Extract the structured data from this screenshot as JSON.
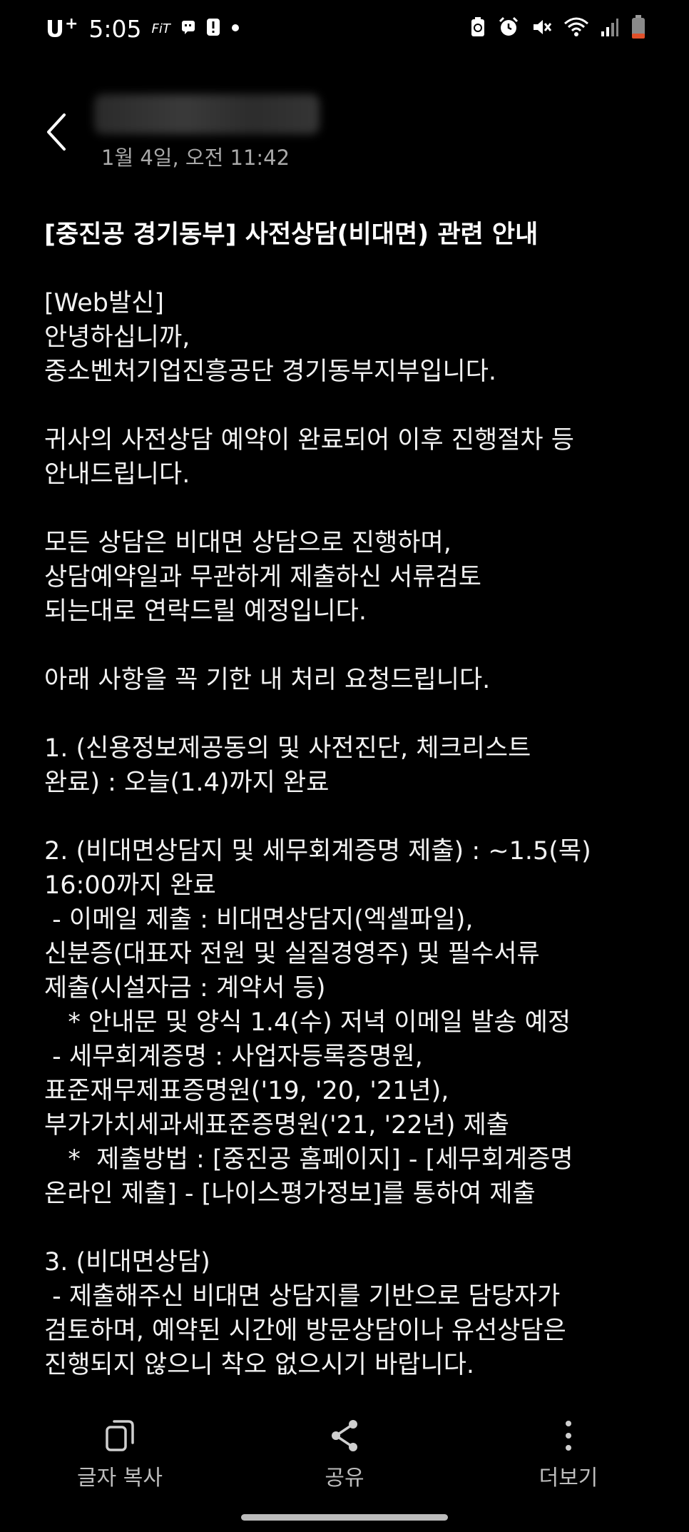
{
  "status_bar": {
    "carrier": "U",
    "carrier_plus": "+",
    "time": "5:05",
    "small_label": "FiT",
    "icons": [
      "message-icon",
      "alert-icon",
      "dot-icon",
      "battery-saver-icon",
      "alarm-icon",
      "mute-icon",
      "wifi-icon",
      "signal-icon",
      "battery-icon"
    ]
  },
  "header": {
    "date": "1월 4일, 오전 11:42"
  },
  "message": {
    "lines": [
      "[중진공 경기동부] 사전상담(비대면) 관련 안내",
      "",
      "[Web발신]",
      "안녕하십니까,",
      "중소벤처기업진흥공단 경기동부지부입니다.",
      "",
      "귀사의 사전상담 예약이 완료되어 이후 진행절차 등",
      "안내드립니다.",
      "",
      "모든 상담은 비대면 상담으로 진행하며,",
      "상담예약일과 무관하게 제출하신 서류검토",
      "되는대로 연락드릴 예정입니다.",
      "",
      "아래 사항을 꼭 기한 내 처리 요청드립니다.",
      "",
      "1. (신용정보제공동의 및 사전진단, 체크리스트",
      "완료) : 오늘(1.4)까지 완료",
      "",
      "2. (비대면상담지 및 세무회계증명 제출) : ~1.5(목)",
      "16:00까지 완료",
      " - 이메일 제출 : 비대면상담지(엑셀파일),",
      "신분증(대표자 전원 및 실질경영주) 및 필수서류",
      "제출(시설자금 : 계약서 등)",
      "   * 안내문 및 양식 1.4(수) 저녁 이메일 발송 예정",
      " - 세무회계증명 : 사업자등록증명원,",
      "표준재무제표증명원('19, '20, '21년),",
      "부가가치세과세표준증명원('21, '22년) 제출",
      "   *  제출방법 : [중진공 홈페이지] - [세무회계증명",
      "온라인 제출] - [나이스평가정보]를 통하여 제출",
      "",
      "3. (비대면상담)",
      " - 제출해주신 비대면 상담지를 기반으로 담당자가",
      "검토하며, 예약된 시간에 방문상담이나 유선상담은",
      "진행되지 않으니 착오 없으시기 바랍니다."
    ]
  },
  "bottom_bar": {
    "copy_label": "글자 복사",
    "share_label": "공유",
    "more_label": "더보기"
  }
}
